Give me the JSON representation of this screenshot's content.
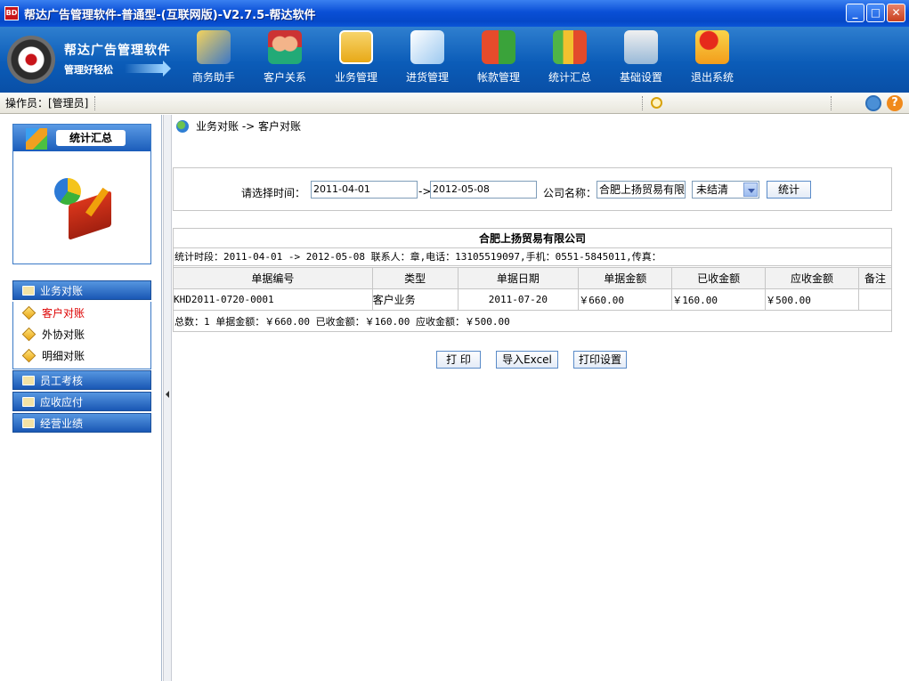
{
  "window": {
    "title": "帮达广告管理软件-普通型-(互联网版)-V2.7.5-帮达软件",
    "logo_badge": "BD"
  },
  "winbuttons": {
    "minimize": "_",
    "maximize": "□",
    "close": "✕"
  },
  "banner": {
    "logo_name": "帮达广告管理软件",
    "logo_slogan": "管理好轻松"
  },
  "nav": [
    {
      "label": "商务助手",
      "icon": "assistant-icon"
    },
    {
      "label": "客户关系",
      "icon": "customers-icon"
    },
    {
      "label": "业务管理",
      "icon": "clipboard-icon"
    },
    {
      "label": "进货管理",
      "icon": "edit-icon"
    },
    {
      "label": "帐款管理",
      "icon": "transfer-icon"
    },
    {
      "label": "统计汇总",
      "icon": "chart-icon"
    },
    {
      "label": "基础设置",
      "icon": "settings-icon"
    },
    {
      "label": "退出系统",
      "icon": "exit-icon"
    }
  ],
  "operator": {
    "label": "操作员：[管理员]"
  },
  "sidebar": {
    "panel_title": "统计汇总",
    "groups": [
      {
        "label": "业务对账",
        "items": [
          {
            "label": "客户对账",
            "active": true
          },
          {
            "label": "外协对账",
            "active": false
          },
          {
            "label": "明细对账",
            "active": false
          }
        ]
      },
      {
        "label": "员工考核"
      },
      {
        "label": "应收应付"
      },
      {
        "label": "经营业绩"
      }
    ]
  },
  "breadcrumb": "业务对账 -> 客户对账",
  "filter": {
    "time_label": "请选择时间：",
    "date_from": "2011-04-01",
    "arrow": "->",
    "date_to": "2012-05-08",
    "company_label": "公司名称：",
    "company_value": "合肥上扬贸易有限",
    "status_value": "未结清",
    "stat_button": "统计"
  },
  "report": {
    "company_title": "合肥上扬贸易有限公司",
    "period_line": "统计时段：2011-04-01 -> 2012-05-08  联系人：章,电话：13105519097,手机：0551-5845011,传真：",
    "columns": [
      "单据编号",
      "类型",
      "单据日期",
      "单据金额",
      "已收金额",
      "应收金额",
      "备注"
    ],
    "rows": [
      [
        "KHD2011-0720-0001",
        "客户业务",
        "2011-07-20",
        "￥660.00",
        "￥160.00",
        "￥500.00",
        ""
      ]
    ],
    "totals_line": "总数：1    单据金额：￥660.00    已收金额：￥160.00    应收金额：￥500.00"
  },
  "actions": {
    "print": "打 印",
    "export_excel": "导入Excel",
    "print_setup": "打印设置"
  },
  "colors": {
    "title_blue": "#0548c8",
    "banner_blue": "#0b5cb8",
    "accent_red": "#dd0000"
  }
}
